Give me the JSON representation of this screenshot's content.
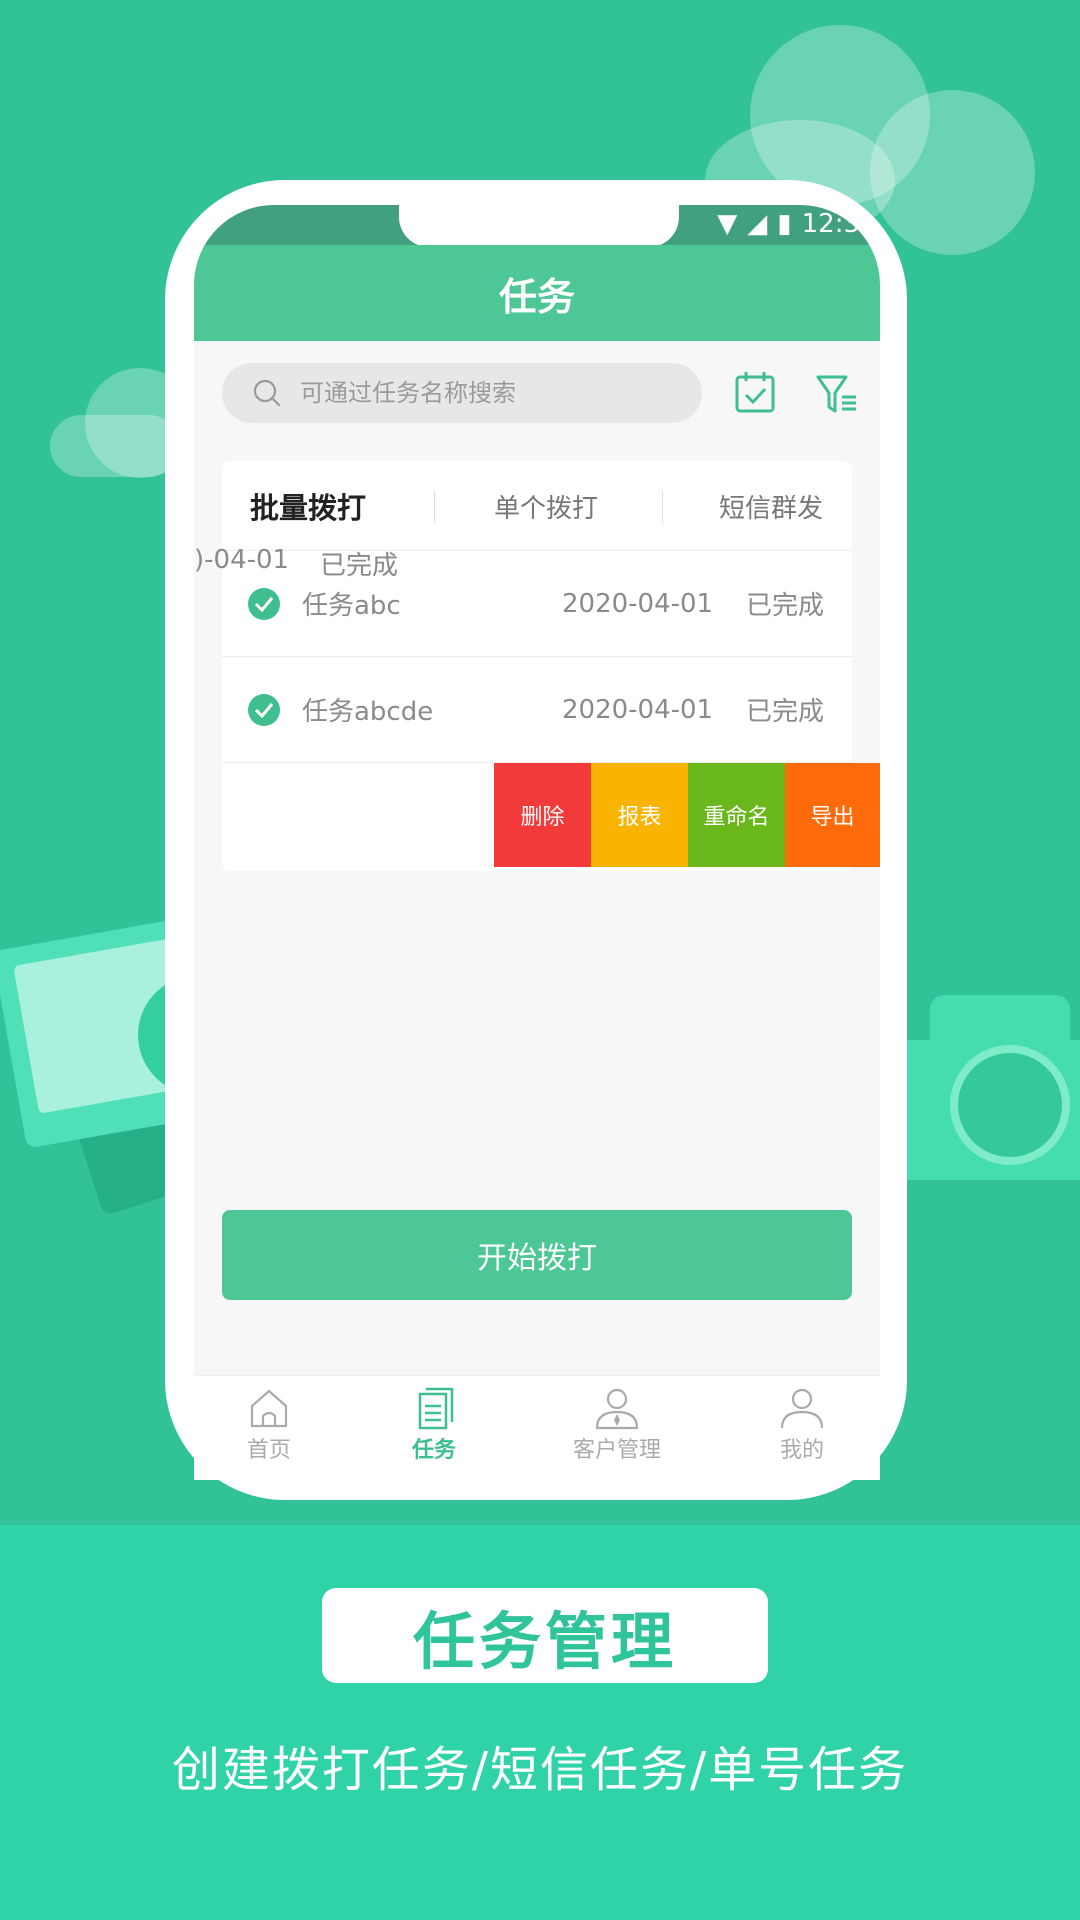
{
  "status_bar": {
    "time": "12:3"
  },
  "appbar": {
    "title": "任务"
  },
  "search": {
    "placeholder": "可通过任务名称搜索"
  },
  "tabs": [
    {
      "label": "批量拨打",
      "active": true
    },
    {
      "label": "单个拨打",
      "active": false
    },
    {
      "label": "短信群发",
      "active": false
    }
  ],
  "tasks": [
    {
      "name": "任务abc",
      "date": "2020-04-01",
      "status": "已完成"
    },
    {
      "name": "任务abcde",
      "date": "2020-04-01",
      "status": "已完成"
    }
  ],
  "swiped_task": {
    "date_fragment": ")-04-01",
    "status": "已完成"
  },
  "swipe_actions": [
    {
      "label": "删除",
      "color": "#f23a3a"
    },
    {
      "label": "报表",
      "color": "#f8b400"
    },
    {
      "label": "重命名",
      "color": "#6bb81c"
    },
    {
      "label": "导出",
      "color": "#ff6a0b"
    }
  ],
  "start_button": {
    "label": "开始拨打"
  },
  "bottom_nav": [
    {
      "label": "首页",
      "icon": "home-icon"
    },
    {
      "label": "任务",
      "icon": "task-icon",
      "active": true
    },
    {
      "label": "客户管理",
      "icon": "customer-icon"
    },
    {
      "label": "我的",
      "icon": "profile-icon"
    }
  ],
  "caption": {
    "title": "任务管理",
    "subtitle": "创建拨打任务/短信任务/单号任务"
  },
  "colors": {
    "brand_green": "#4cc795",
    "background": "#31c298"
  }
}
